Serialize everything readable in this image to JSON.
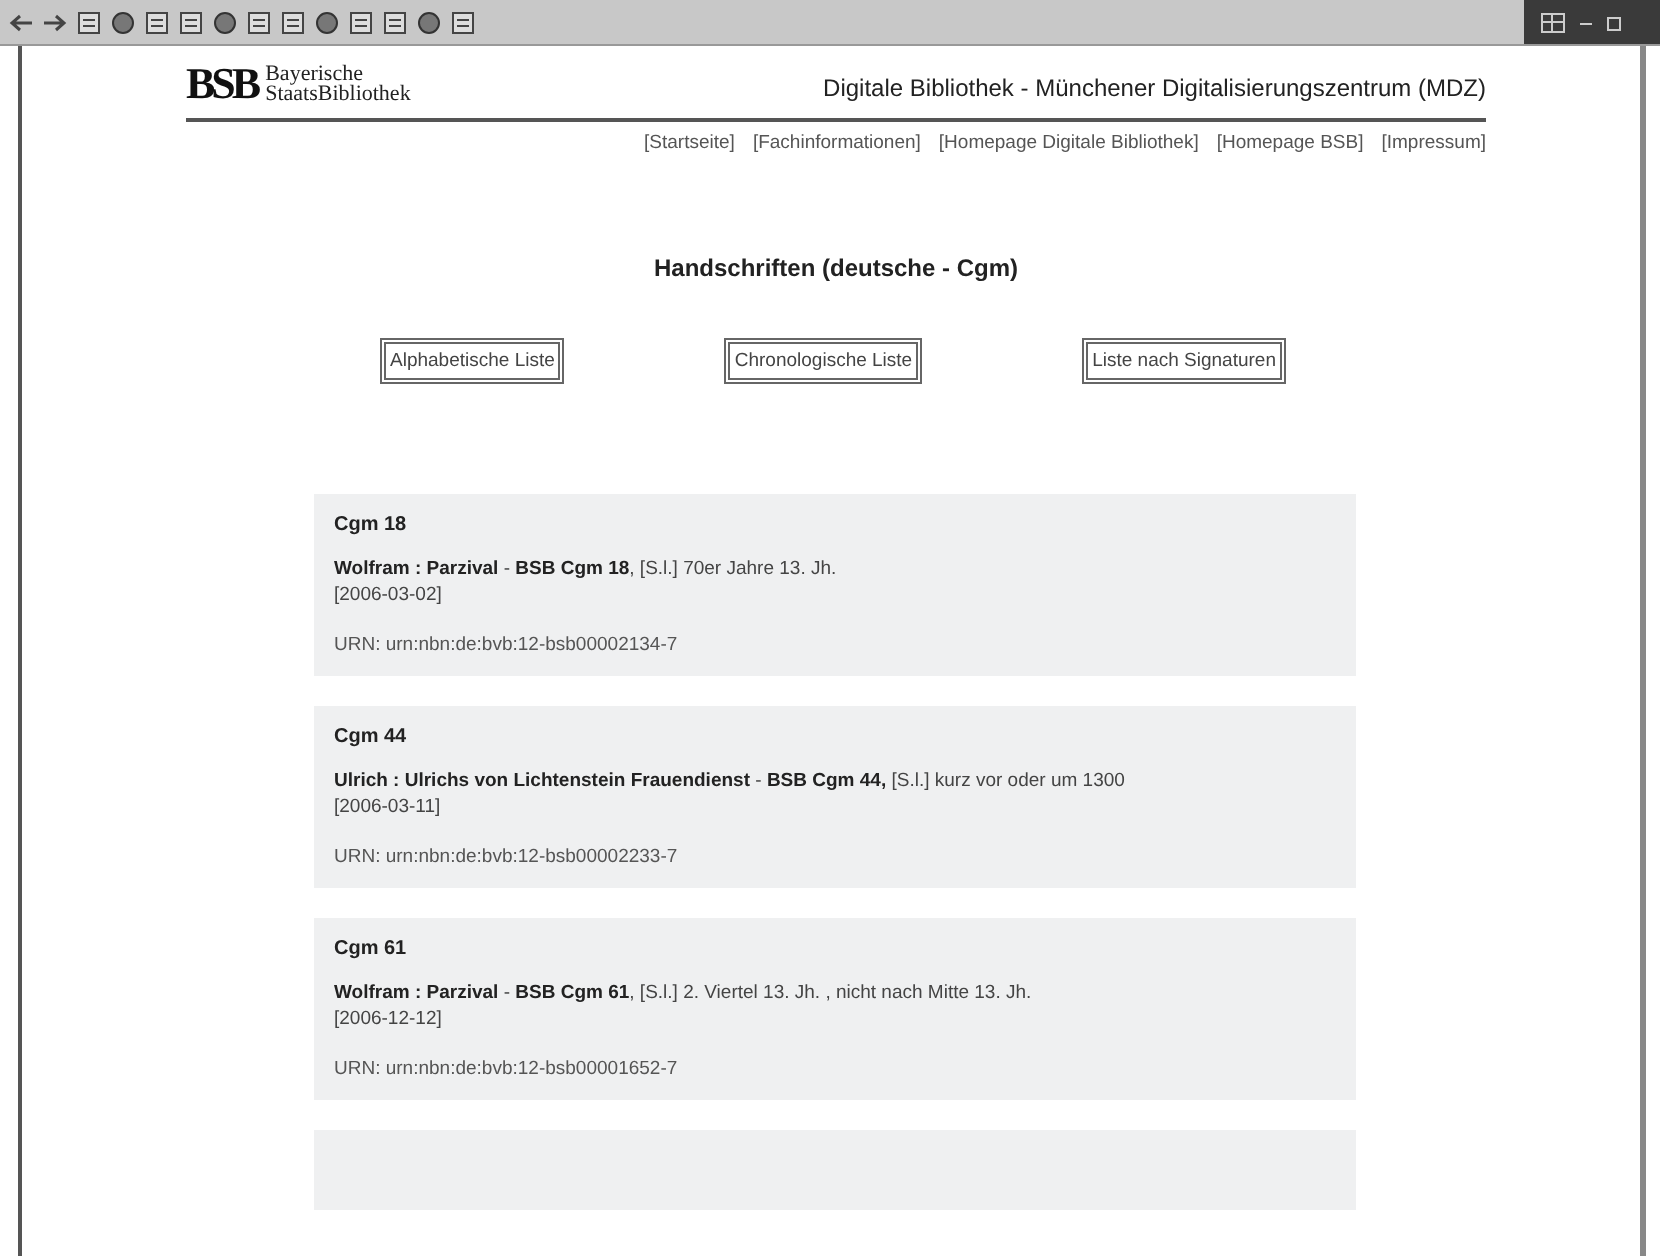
{
  "header": {
    "logo_mark": "BSB",
    "logo_text": [
      "Bayerische",
      "StaatsBibliothek"
    ],
    "title": "Digitale Bibliothek - Münchener Digitalisierungszentrum (MDZ)"
  },
  "nav": [
    "[Startseite]",
    "[Fachinformationen]",
    "[Homepage Digitale Bibliothek]",
    "[Homepage BSB]",
    "[Impressum]"
  ],
  "heading": "Handschriften (deutsche - Cgm)",
  "list_buttons": [
    "Alphabetische Liste",
    "Chronologische Liste",
    "Liste nach Signaturen"
  ],
  "records": [
    {
      "shelfmark": "Cgm 18",
      "description": "**Wolfram : Parzival** - **BSB Cgm 18**, [S.l.] 70er Jahre 13. Jh.",
      "date": "[2006-03-02]",
      "urn": "URN: urn:nbn:de:bvb:12-bsb00002134-7"
    },
    {
      "shelfmark": "Cgm 44",
      "description": "**Ulrich : Ulrichs von Lichtenstein Frauendienst** - **BSB Cgm 44,** [S.l.] kurz vor oder um 1300",
      "date": "[2006-03-11]",
      "urn": "URN: urn:nbn:de:bvb:12-bsb00002233-7"
    },
    {
      "shelfmark": "Cgm 61",
      "description": "**Wolfram : Parzival** - **BSB Cgm 61**, [S.l.] 2. Viertel 13. Jh. , nicht nach Mitte 13. Jh.",
      "date": "[2006-12-12]",
      "urn": "URN: urn:nbn:de:bvb:12-bsb00001652-7"
    }
  ]
}
